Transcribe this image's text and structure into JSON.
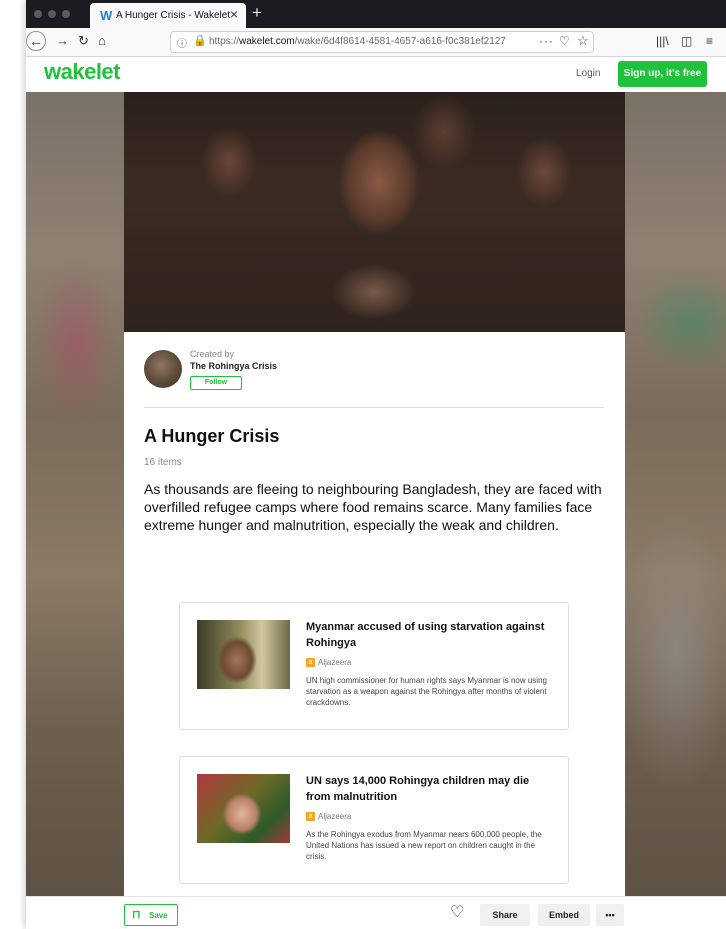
{
  "browser": {
    "tab_title": "A Hunger Crisis - Wakelet",
    "tab_favicon": "W",
    "url_prefix": "https://",
    "url_domain": "wakelet.com",
    "url_path": "/wake/6d4f8614-4581-4657-a616-f0c381ef2127",
    "icons": [
      "back-icon",
      "forward-icon",
      "reload-icon",
      "home-icon",
      "info-icon",
      "lock-icon",
      "more-icon",
      "pocket-icon",
      "star-icon",
      "library-icon",
      "sidebar-icon",
      "menu-icon"
    ]
  },
  "site": {
    "logo": "wakelet",
    "login_label": "Login",
    "signup_label": "Sign up, it's free",
    "accent_color": "#1fc13d"
  },
  "collection": {
    "created_by_label": "Created by",
    "creator_name": "The Rohingya Crisis",
    "follow_label": "Follow",
    "title": "A Hunger Crisis",
    "item_count": "16 items",
    "description": "As thousands are fleeing to neighbouring Bangladesh, they are faced with overfilled refugee camps where food remains scarce. Many families face extreme hunger and malnutrition, especially the weak and children."
  },
  "items": [
    {
      "title": "Myanmar accused of using starvation against Rohingya",
      "source": "Aljazeera",
      "description": "UN high commissioner for human rights says Myanmar is now using starvation as a weapon against the Rohingya after months of violent crackdowns."
    },
    {
      "title": "UN says 14,000 Rohingya children may die from malnutrition",
      "source": "Aljazeera",
      "description": "As the Rohingya exodus from Myanmar nears 600,000 people, the United Nations has issued a new report on children caught in the crisis."
    }
  ],
  "footer": {
    "save_label": "Save",
    "share_label": "Share",
    "embed_label": "Embed",
    "more_label": "•••"
  }
}
